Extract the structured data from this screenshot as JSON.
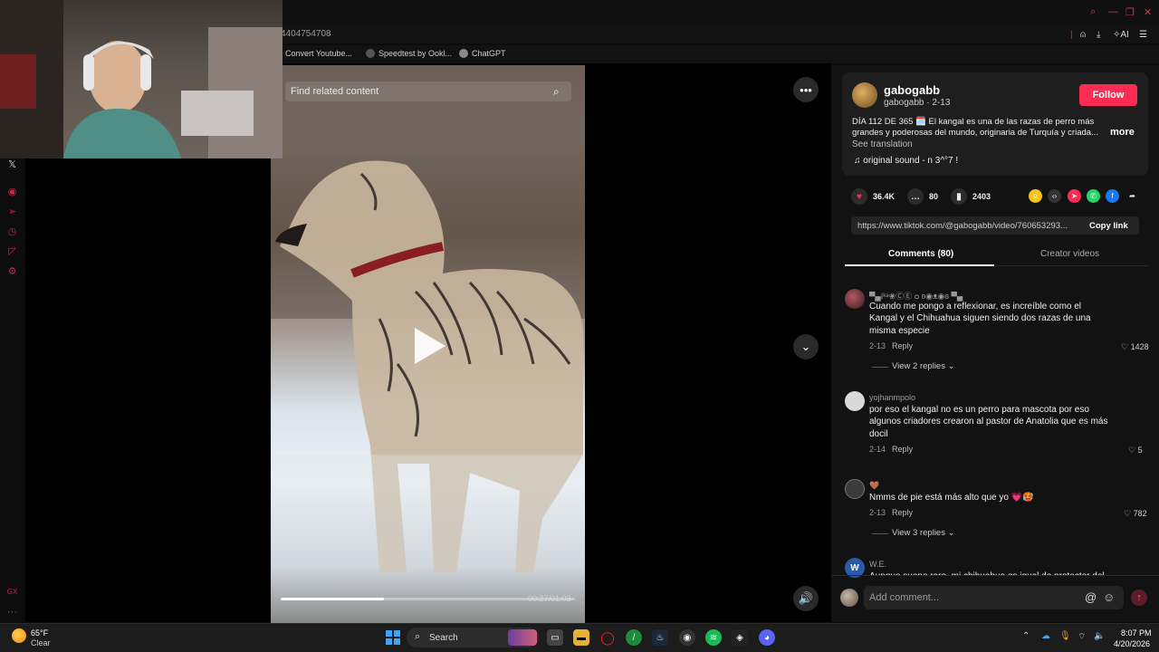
{
  "browser": {
    "url_fragment": "4404754708",
    "bookmarks": [
      {
        "label": "Convert Youtube..."
      },
      {
        "label": "Speedtest by Ookl..."
      },
      {
        "label": "ChatGPT"
      }
    ],
    "toolbar_ai_label": "AI"
  },
  "video": {
    "search_placeholder": "Find related content",
    "progress": 0.35,
    "time": "00:27/01:03"
  },
  "post": {
    "username": "gabogabb",
    "handle_date": "gabogabb · 2-13",
    "follow_label": "Follow",
    "description": "DÍA 112 DE 365 🗓️ El kangal es una de las razas de perro más grandes y poderosas del mundo, originaria de Turquía y criada...",
    "more_label": "more",
    "see_translation": "See translation",
    "sound": "♫  original sound - n 3^°7 !",
    "likes": "36.4K",
    "comments_count": "80",
    "saves": "2403",
    "link": "https://www.tiktok.com/@gabogabb/video/760653293...",
    "copy_link_label": "Copy link"
  },
  "tabs": {
    "comments": "Comments (80)",
    "creator": "Creator videos"
  },
  "comments": [
    {
      "name": "▀▄íᵏᵃ❀ⒸⒺ ᴑ ʚ◉ᴥ◉ɞ ▀▄",
      "text_lines": [
        "Cuando me pongo a reflexionar, es increíble como el",
        "Kangal y el Chihuahua siguen siendo dos razas de una",
        "misma especie"
      ],
      "date": "2-13",
      "reply": "Reply",
      "likes": "1428",
      "replies": "View 2 replies"
    },
    {
      "name": "yojhanmpolo",
      "text_lines": [
        "por eso el kangal no es un perro para mascota por eso",
        "algunos criadores crearon al pastor de Anatolia que es más",
        "docil"
      ],
      "date": "2-14",
      "reply": "Reply",
      "likes": "5"
    },
    {
      "name": "🤎",
      "text_lines": [
        "Nmms de pie está más alto que yo 💗🥵"
      ],
      "date": "2-13",
      "reply": "Reply",
      "likes": "782",
      "replies": "View 3 replies"
    },
    {
      "name": "W.E.",
      "text_lines": [
        "Aunque suene raro, mi chihuahua es igual de protector del"
      ],
      "avatar_letter": "W"
    }
  ],
  "comment_input": {
    "placeholder": "Add comment..."
  },
  "taskbar": {
    "temp": "65°F",
    "condition": "Clear",
    "search_label": "Search",
    "time": "8:07 PM",
    "date": "4/20/2026"
  },
  "colors": {
    "accent": "#fe2c55",
    "sidebar_icon": "#d0204a",
    "start": "#3fa3ff"
  }
}
